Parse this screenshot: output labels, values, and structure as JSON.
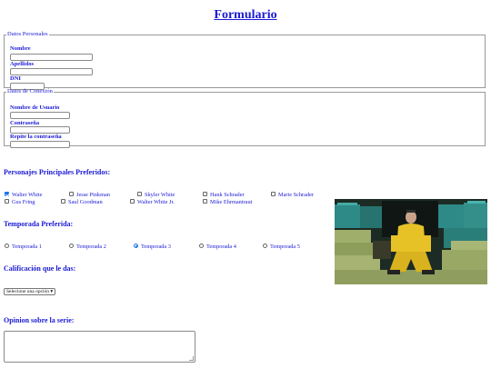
{
  "page": {
    "title": "Formulario"
  },
  "personal": {
    "legend": "Datos Personales",
    "nombre_label": "Nombre",
    "apellidos_label": "Apellidos",
    "dni_label": "DNI",
    "nombre_value": "",
    "apellidos_value": "",
    "dni_value": ""
  },
  "conexion": {
    "legend": "Datos de Conexión",
    "usuario_label": "Nombre de Usuario",
    "password_label": "Contraseña",
    "repeat_label": "Repite la contraseña"
  },
  "personajes": {
    "heading": "Personajes Principales Preferidos:",
    "options": [
      {
        "label": "Walter White",
        "checked": true
      },
      {
        "label": "Jesse Pinkman",
        "checked": false
      },
      {
        "label": "Skyler White",
        "checked": false
      },
      {
        "label": "Hank Schrader",
        "checked": false
      },
      {
        "label": "Marie Schrader",
        "checked": false
      },
      {
        "label": "Gus Fring",
        "checked": false
      },
      {
        "label": "Saul Goodman",
        "checked": false
      },
      {
        "label": "Walter White Jr.",
        "checked": false
      },
      {
        "label": "Mike Ehrmantraut",
        "checked": false
      }
    ]
  },
  "temporada": {
    "heading": "Temporada Preferida:",
    "options": [
      {
        "label": "Temporada 1",
        "checked": false
      },
      {
        "label": "Temporada 2",
        "checked": false
      },
      {
        "label": "Temporada 3",
        "checked": true
      },
      {
        "label": "Temporada 4",
        "checked": false
      },
      {
        "label": "Temporada 5",
        "checked": false
      }
    ]
  },
  "calificacion": {
    "heading": "Calificación que le das:",
    "selected": "Selecione una opción"
  },
  "opinion": {
    "heading": "Opinion sobre la serie:",
    "value": ""
  },
  "colors": {
    "text": "#1a1ad4",
    "accent": "#1a73e8"
  }
}
